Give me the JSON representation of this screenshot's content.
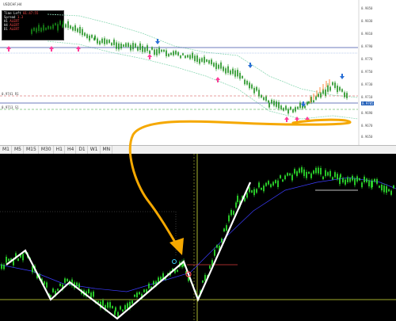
{
  "top_chart": {
    "title": "USDCHF,H4",
    "info_panel": [
      {
        "label": "Time Left",
        "value": "01:47:55"
      },
      {
        "label": "Spread",
        "value": "1.3"
      },
      {
        "label": "H1",
        "value": "ALERT"
      },
      {
        "label": "H4",
        "value": "ALERT"
      },
      {
        "label": "D1",
        "value": "ALERT"
      }
    ],
    "price_labels": [
      "0.9850",
      "0.9830",
      "0.9810",
      "0.9790",
      "0.9770",
      "0.9750",
      "0.9730",
      "0.9710",
      "0.9690",
      "0.9670",
      "0.9650"
    ],
    "line_labels": [
      {
        "text": "0.9741 R1"
      },
      {
        "text": "0.9713 S1"
      }
    ],
    "current_price": "0.9705",
    "colors": {
      "candle": "#1a8f1a",
      "upper_band": "#8fd9b6",
      "lower_band": "#8fd9b6",
      "buy_arrow": "#ff3d9a",
      "sell_arrow": "#2a6fd6",
      "horizontal_blue": "#3b4fa8",
      "horizontal_red": "#d04040",
      "horizontal_green": "#2ca02c",
      "annotation": "#f5a800"
    }
  },
  "timeframe_tabs": [
    "M1",
    "M5",
    "M15",
    "M30",
    "H1",
    "H4",
    "D1",
    "W1",
    "MN"
  ],
  "bottom_chart": {
    "colors": {
      "background": "#000000",
      "candle": "#2ddc2d",
      "zigzag": "#ffffff",
      "level_line": "#d8e63c",
      "red_line": "#d83a3a",
      "ma_line": "#3c3cff"
    }
  }
}
